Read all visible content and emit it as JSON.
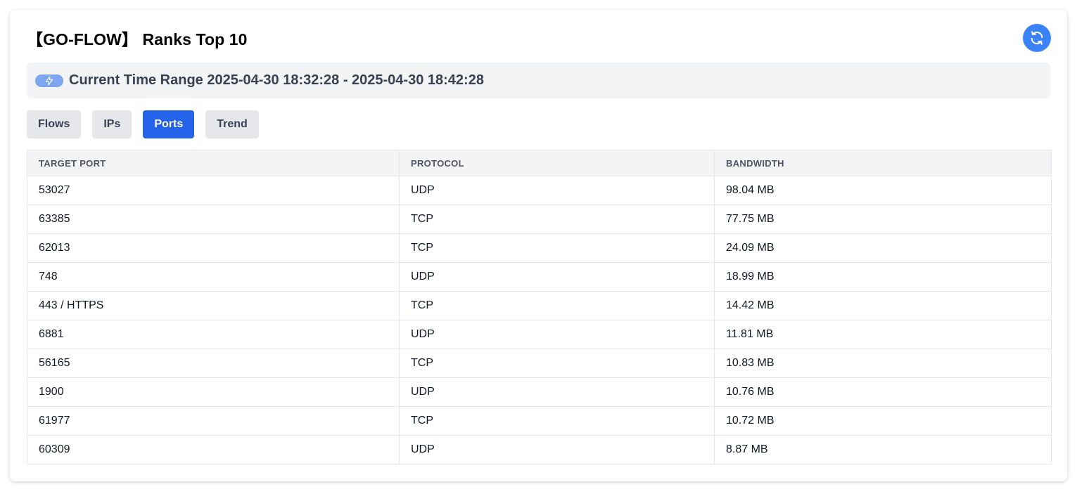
{
  "header": {
    "title": "【GO-FLOW】 Ranks Top 10",
    "refresh_icon": "refresh-icon"
  },
  "time_range": {
    "badge_icon": "lightning-icon",
    "text": "Current Time Range 2025-04-30 18:32:28 - 2025-04-30 18:42:28"
  },
  "tabs": [
    {
      "label": "Flows",
      "active": false
    },
    {
      "label": "IPs",
      "active": false
    },
    {
      "label": "Ports",
      "active": true
    },
    {
      "label": "Trend",
      "active": false
    }
  ],
  "table": {
    "columns": [
      "TARGET PORT",
      "PROTOCOL",
      "BANDWIDTH"
    ],
    "rows": [
      [
        "53027",
        "UDP",
        "98.04 MB"
      ],
      [
        "63385",
        "TCP",
        "77.75 MB"
      ],
      [
        "62013",
        "TCP",
        "24.09 MB"
      ],
      [
        "748",
        "UDP",
        "18.99 MB"
      ],
      [
        "443 / HTTPS",
        "TCP",
        "14.42 MB"
      ],
      [
        "6881",
        "UDP",
        "11.81 MB"
      ],
      [
        "56165",
        "TCP",
        "10.83 MB"
      ],
      [
        "1900",
        "UDP",
        "10.76 MB"
      ],
      [
        "61977",
        "TCP",
        "10.72 MB"
      ],
      [
        "60309",
        "UDP",
        "8.87 MB"
      ]
    ]
  },
  "colors": {
    "accent": "#2563eb",
    "refresh_bg": "#3b82f6",
    "badge_bg": "#7ea6f0",
    "panel_bg": "#f3f4f6",
    "tab_bg": "#e5e7eb"
  }
}
